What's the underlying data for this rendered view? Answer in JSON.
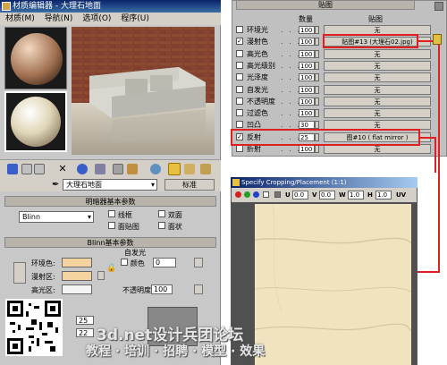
{
  "material_editor": {
    "title": "材质编辑器 - 大理石地面",
    "menu": [
      "材质(M)",
      "导航(N)",
      "选项(O)",
      "程序(U)"
    ],
    "material_name": "大理石地面",
    "type_button": "标准",
    "shader_rollout": "明暗器基本参数",
    "shader_value": "Blinn",
    "shader_options": [
      "线框",
      "双面",
      "面贴图",
      "面状"
    ],
    "blinn_rollout": "Blinn基本参数",
    "self_illum_label": "自发光",
    "color_label": "颜色",
    "color_value": "0",
    "ambient_label": "环境色:",
    "diffuse_label": "漫射区:",
    "specular_label": "高光区:",
    "opacity_label": "不透明度:",
    "opacity_value": "100",
    "spec_level_value": "25",
    "gloss_value": "22"
  },
  "maps": {
    "header": "贴图",
    "col_amount": "数量",
    "col_map": "贴图",
    "rows": [
      {
        "name": "环境光",
        "amount": "100",
        "map": "无",
        "checked": false
      },
      {
        "name": "漫射色",
        "amount": "100",
        "map": "贴图#13 (大理石02.jpg)",
        "checked": true
      },
      {
        "name": "高光色",
        "amount": "100",
        "map": "无",
        "checked": false
      },
      {
        "name": "高光级别",
        "amount": "100",
        "map": "无",
        "checked": false
      },
      {
        "name": "光泽度",
        "amount": "100",
        "map": "无",
        "checked": false
      },
      {
        "name": "自发光",
        "amount": "100",
        "map": "无",
        "checked": false
      },
      {
        "name": "不透明度",
        "amount": "100",
        "map": "无",
        "checked": false
      },
      {
        "name": "过滤色",
        "amount": "100",
        "map": "无",
        "checked": false
      },
      {
        "name": "凹凸",
        "amount": "30",
        "map": "无",
        "checked": false
      },
      {
        "name": "反射",
        "amount": "25",
        "map": "图#10 ( flat mirror )",
        "checked": true
      },
      {
        "name": "折射",
        "amount": "100",
        "map": "无",
        "checked": false
      }
    ]
  },
  "crop_window": {
    "title": "Specify Cropping/Placement (1:1)",
    "u_label": "U",
    "u_value": "0.0",
    "v_label": "V",
    "v_value": "0.0",
    "w_label": "W",
    "w_value": "1.0",
    "h_label": "H",
    "h_value": "1.0",
    "uv_label": "UV"
  },
  "watermark": {
    "line1": "3d.net设计兵团论坛",
    "line2": "教程 · 培训 · 招聘 · 模型 · 效果"
  },
  "colors": {
    "accent_red": "#e02020",
    "ambient_swatch": "#f3d4a0",
    "title_blue": "#0a246a"
  }
}
